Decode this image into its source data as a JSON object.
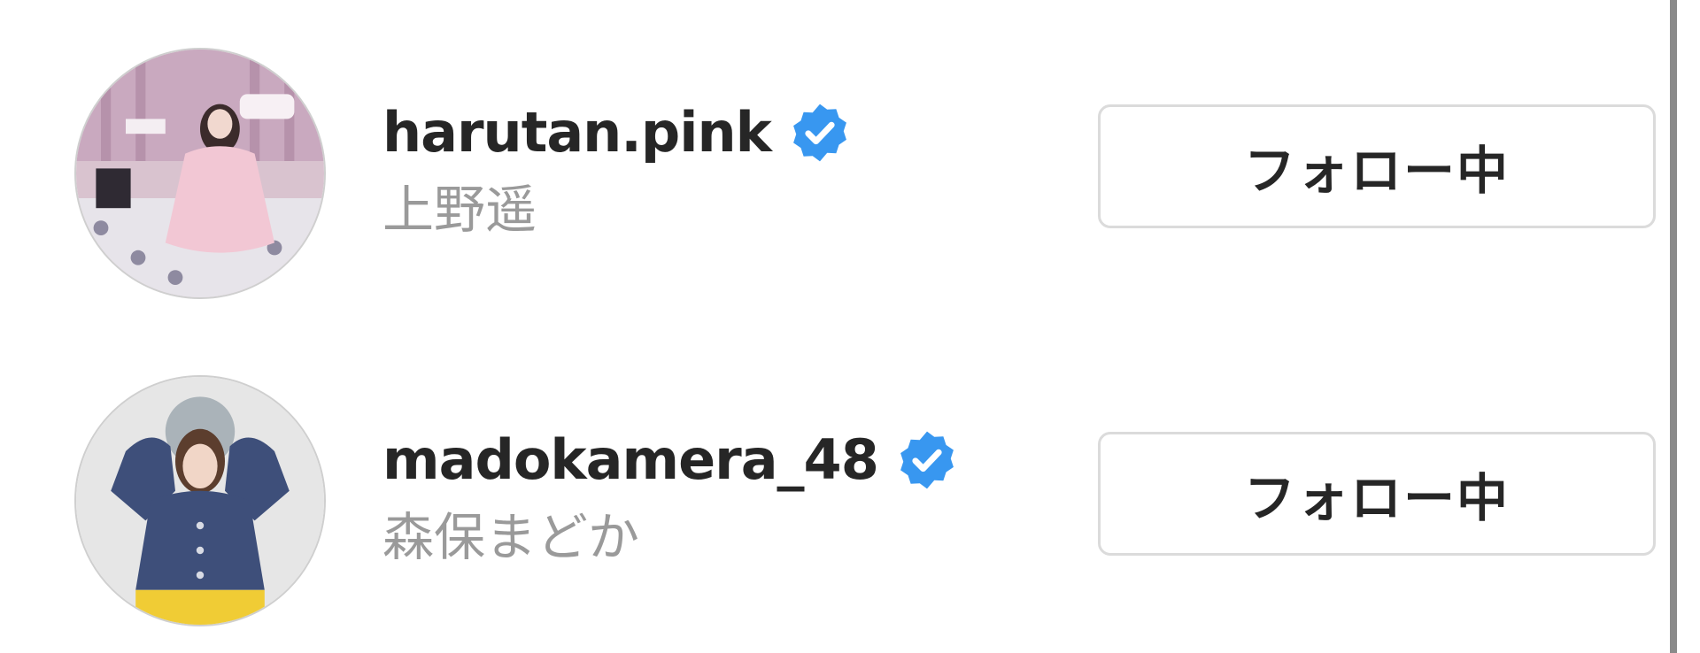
{
  "accounts": [
    {
      "username": "harutan.pink",
      "full_name": "上野遥",
      "verified": true,
      "button_label": "フォロー中",
      "avatar": "profile-photo-woman-pink-dress"
    },
    {
      "username": "madokamera_48",
      "full_name": "森保まどか",
      "verified": true,
      "button_label": "フォロー中",
      "avatar": "profile-photo-woman-navy-shirt"
    }
  ],
  "colors": {
    "verified_badge": "#3897f0",
    "username_text": "#262626",
    "fullname_text": "#9a9a9a",
    "button_border": "#dbdbdb"
  },
  "icons": {
    "verified": "verified-badge-icon"
  }
}
